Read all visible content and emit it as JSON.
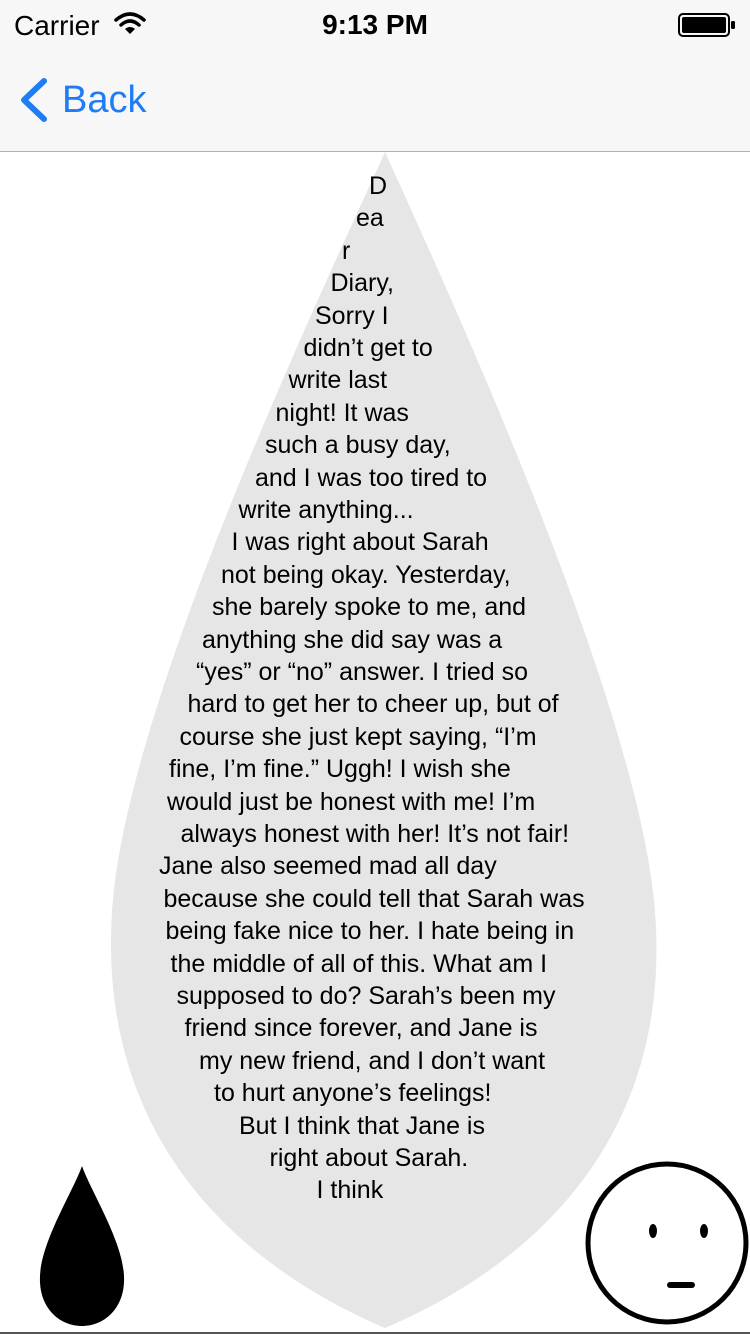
{
  "status_bar": {
    "carrier": "Carrier",
    "time": "9:13 PM",
    "wifi_icon": "wifi-icon",
    "battery_icon": "battery-icon"
  },
  "nav": {
    "back_label": "Back",
    "back_icon": "chevron-left-icon",
    "accent_color": "#1e7cf5"
  },
  "diary": {
    "drop_fill": "#e6e6e6",
    "lines": [
      "D",
      "ea",
      "r",
      "Diary,",
      "Sorry I",
      "didn’t get to",
      "write last",
      "night! It was",
      "such a busy day,",
      "and I was too tired to",
      "write anything...",
      "I was right about Sarah",
      "not being okay. Yesterday,",
      "she barely spoke to me, and",
      "anything she did say was a",
      "“yes” or “no” answer.  I tried so",
      "hard to get her to cheer up, but of",
      "course she just kept saying, “I’m",
      "fine, I’m fine.” Uggh! I wish she",
      "would just be honest with me! I’m",
      "always honest with her! It’s not fair!",
      "Jane also seemed mad all day",
      "because she could tell that Sarah was",
      "being fake nice to her. I hate being in",
      "the middle of all of this. What am I",
      "supposed to do? Sarah’s been my",
      "friend since forever, and Jane is",
      "my new friend, and I don’t want",
      "to hurt anyone’s feelings!",
      "But I think that Jane is",
      "right about Sarah.",
      "I think"
    ]
  },
  "footer": {
    "ink_drop_icon": "ink-drop-icon",
    "mood_face_icon": "neutral-face-icon"
  }
}
